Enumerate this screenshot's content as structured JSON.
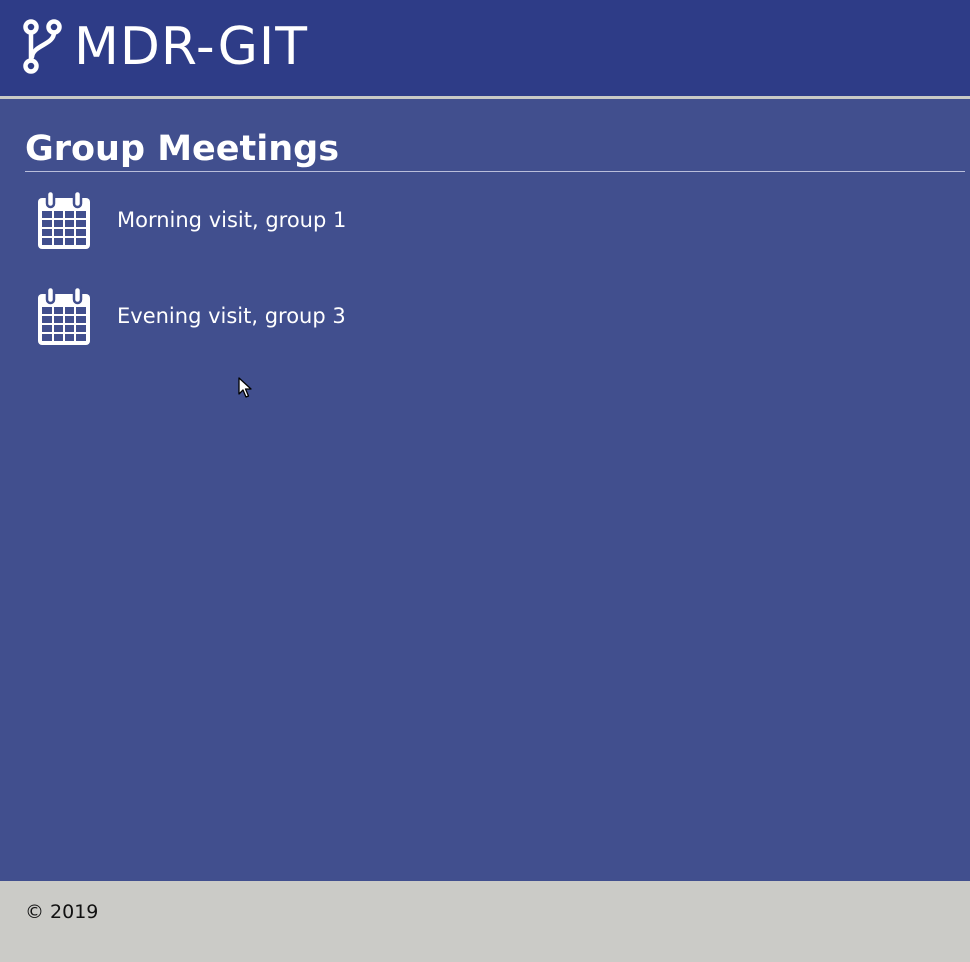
{
  "header": {
    "brand_icon": "git-branch-icon",
    "brand_text": "MDR-GIT"
  },
  "main": {
    "title": "Group Meetings",
    "meetings": [
      {
        "icon": "calendar-icon",
        "label": "Morning visit, group 1"
      },
      {
        "icon": "calendar-icon",
        "label": "Evening visit, group 3"
      }
    ]
  },
  "footer": {
    "copyright": "© 2019"
  },
  "colors": {
    "header_bg": "#2e3c87",
    "page_bg": "#414f8e",
    "footer_bg": "#cbcbc7",
    "divider": "#c9cac6",
    "text": "#ffffff"
  }
}
